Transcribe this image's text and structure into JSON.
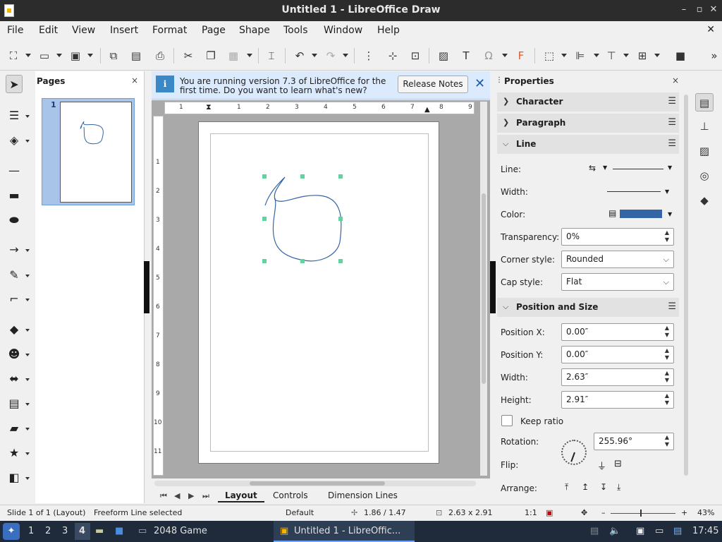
{
  "window": {
    "title": "Untitled 1 - LibreOffice Draw",
    "minimize": "–",
    "restore": "▫",
    "close": "✕"
  },
  "menu": {
    "items": [
      "File",
      "Edit",
      "View",
      "Insert",
      "Format",
      "Page",
      "Shape",
      "Tools",
      "Window",
      "Help"
    ],
    "close": "✕"
  },
  "pages_pane": {
    "title": "Pages",
    "close": "×",
    "page_number": "1"
  },
  "infobar": {
    "message": "You are running version 7.3 of LibreOffice for the first time. Do you want to learn what's new?",
    "button": "Release Notes",
    "close": "✕",
    "icon": "i"
  },
  "ruler": {
    "h": [
      "1",
      "1",
      "2",
      "3",
      "4",
      "5",
      "6",
      "7",
      "8",
      "9"
    ],
    "v": [
      "1",
      "2",
      "3",
      "4",
      "5",
      "6",
      "7",
      "8",
      "9",
      "10",
      "11"
    ]
  },
  "tabs": [
    "Layout",
    "Controls",
    "Dimension Lines"
  ],
  "nav": [
    "⏮",
    "◀",
    "▶",
    "⏭"
  ],
  "properties": {
    "title": "Properties",
    "close": "×",
    "sections": {
      "character": "Character",
      "paragraph": "Paragraph",
      "line": "Line",
      "position": "Position and Size"
    },
    "line": {
      "line_label": "Line:",
      "width_label": "Width:",
      "color_label": "Color:",
      "transparency_label": "Transparency:",
      "transparency_value": "0%",
      "corner_label": "Corner style:",
      "corner_value": "Rounded",
      "cap_label": "Cap style:",
      "cap_value": "Flat",
      "color_hex": "#3465a4"
    },
    "position": {
      "x_label": "Position X:",
      "x_value": "0.00″",
      "y_label": "Position Y:",
      "y_value": "0.00″",
      "width_label": "Width:",
      "width_value": "2.63″",
      "height_label": "Height:",
      "height_value": "2.91″",
      "keep_ratio": "Keep ratio",
      "rotation_label": "Rotation:",
      "rotation_value": "255.96°",
      "flip_label": "Flip:",
      "arrange_label": "Arrange:"
    }
  },
  "status": {
    "slide": "Slide 1 of 1 (Layout)",
    "selection": "Freeform Line selected",
    "style": "Default",
    "position": "1.86 / 1.47",
    "size": "2.63 x 2.91",
    "scale": "1:1",
    "zoom": "43%",
    "zoom_minus": "–",
    "zoom_plus": "+"
  },
  "taskbar": {
    "workspaces": [
      "1",
      "2",
      "3",
      "4"
    ],
    "app1": "2048 Game",
    "app2": "Untitled 1 - LibreOffic...",
    "time": "17:45"
  },
  "colors": {
    "accent": "#3465a4",
    "selection_handle": "#5fd3a0",
    "infobar": "#dceafd"
  }
}
